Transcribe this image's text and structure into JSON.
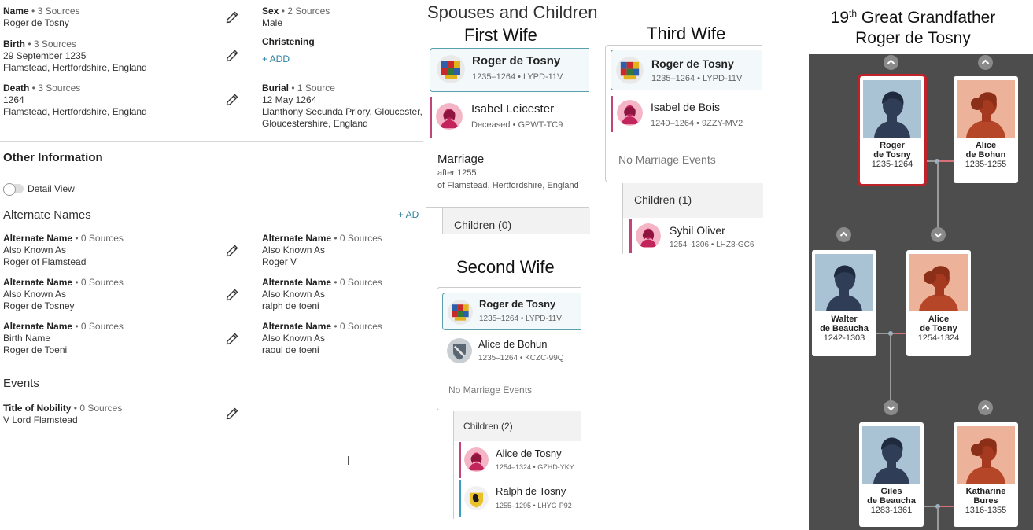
{
  "vitals": {
    "name": {
      "label": "Name",
      "sources": "3 Sources",
      "value": "Roger de Tosny"
    },
    "sex": {
      "label": "Sex",
      "sources": "2 Sources",
      "value": "Male"
    },
    "birth": {
      "label": "Birth",
      "sources": "3 Sources",
      "date": "29 September 1235",
      "place": "Flamstead, Hertfordshire, England"
    },
    "christening": {
      "label": "Christening",
      "add": "+  ADD"
    },
    "death": {
      "label": "Death",
      "sources": "3 Sources",
      "date": "1264",
      "place": "Flamstead, Hertfordshire, England"
    },
    "burial": {
      "label": "Burial",
      "sources": "1 Source",
      "date": "12 May 1264",
      "place1": "Llanthony Secunda Priory, Gloucester,",
      "place2": "Gloucestershire, England"
    }
  },
  "other_info": {
    "title": "Other Information",
    "detail_view": "Detail View",
    "alt_names_title": "Alternate Names",
    "add": "+  AD",
    "alt_names": [
      {
        "label": "Alternate Name",
        "sources": "0 Sources",
        "type": "Also Known As",
        "value": "Roger of Flamstead"
      },
      {
        "label": "Alternate Name",
        "sources": "0 Sources",
        "type": "Also Known As",
        "value": "Roger V"
      },
      {
        "label": "Alternate Name",
        "sources": "0 Sources",
        "type": "Also Known As",
        "value": "Roger de Tosney"
      },
      {
        "label": "Alternate Name",
        "sources": "0 Sources",
        "type": "Also Known As",
        "value": "ralph de toeni"
      },
      {
        "label": "Alternate Name",
        "sources": "0 Sources",
        "type": "Birth Name",
        "value": "Roger de Toeni"
      },
      {
        "label": "Alternate Name",
        "sources": "0 Sources",
        "type": "Also Known As",
        "value": "raoul de toeni"
      }
    ],
    "events_title": "Events",
    "event": {
      "label": "Title of Nobility",
      "sources": "0 Sources",
      "value": "V Lord Flamstead"
    }
  },
  "spouses": {
    "title": "Spouses and Children",
    "first": {
      "heading": "First Wife",
      "husband": {
        "name": "Roger de Tosny",
        "meta": "1235–1264 •  LYPD-11V"
      },
      "wife": {
        "name": "Isabel Leicester",
        "meta": "Deceased •  GPWT-TC9"
      },
      "marriage_label": "Marriage",
      "marriage_date": "after 1255",
      "marriage_place": "of Flamstead, Hertfordshire, England",
      "children": "Children (0)"
    },
    "second": {
      "heading": "Second Wife",
      "husband": {
        "name": "Roger de Tosny",
        "meta": "1235–1264 •  LYPD-11V"
      },
      "wife": {
        "name": "Alice de Bohun",
        "meta": "1235–1264 •  KCZC-99Q"
      },
      "no_marriage": "No Marriage Events",
      "children": "Children (2)",
      "kids": [
        {
          "name": "Alice de Tosny",
          "meta": "1254–1324 •  GZHD-YKY"
        },
        {
          "name": "Ralph de Tosny",
          "meta": "1255–1295 •  LHYG-P92"
        }
      ]
    },
    "third": {
      "heading": "Third Wife",
      "husband": {
        "name": "Roger de Tosny",
        "meta": "1235–1264 •  LYPD-11V"
      },
      "wife": {
        "name": "Isabel de Bois",
        "meta": "1240–1264 •  9ZZY-MV2"
      },
      "no_marriage": "No Marriage Events",
      "children": "Children (1)",
      "kids": [
        {
          "name": "Sybil Oliver",
          "meta": "1254–1306 •  LHZ8-GC6"
        }
      ]
    }
  },
  "tree": {
    "title_num": "19",
    "title_sup": "th",
    "title_rest": " Great Grandfather",
    "title_name": "Roger de Tosny",
    "people": {
      "roger": {
        "first": "Roger",
        "last": "de Tosny",
        "years": "1235-1264"
      },
      "alice_bohun": {
        "first": "Alice",
        "last": "de Bohun",
        "years": "1235-1255"
      },
      "walter": {
        "first": "Walter",
        "last": "de Beaucha",
        "years": "1242-1303"
      },
      "alice_tosny": {
        "first": "Alice",
        "last": "de Tosny",
        "years": "1254-1324"
      },
      "giles": {
        "first": "Giles",
        "last": "de Beaucha",
        "years": "1283-1361"
      },
      "katharine": {
        "first": "Katharine",
        "last": "Bures",
        "years": "1316-1355"
      }
    }
  },
  "colors": {
    "accent": "#2a7f9e",
    "selected": "#c0222a",
    "female_bar": "#c2457a",
    "male_bar": "#3b9fc1",
    "tree_bg": "#4d4d4d"
  }
}
